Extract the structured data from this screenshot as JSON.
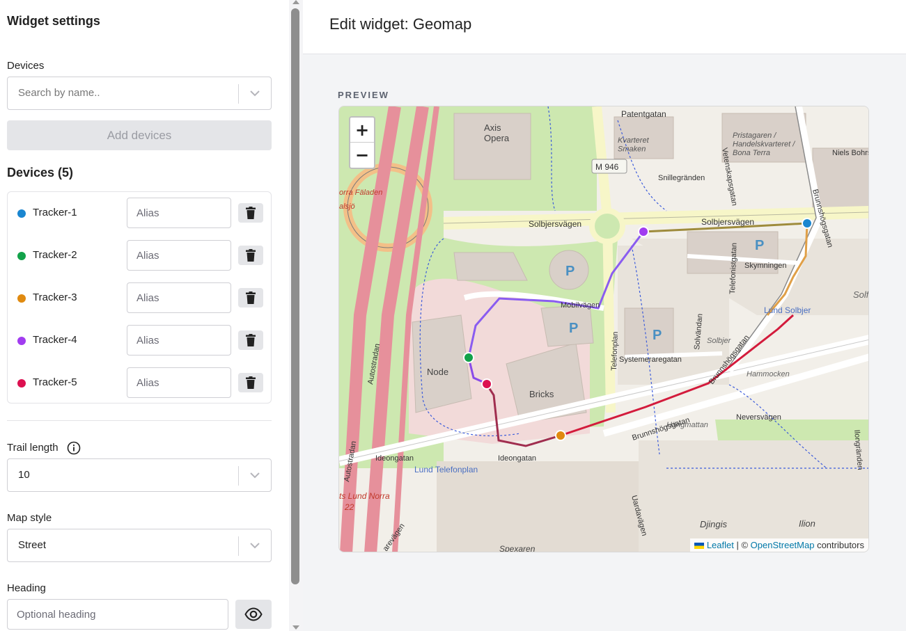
{
  "sidebar": {
    "title": "Widget settings",
    "devices_label": "Devices",
    "search_placeholder": "Search by name..",
    "add_devices_label": "Add devices",
    "devices_heading": "Devices (5)",
    "devices": [
      {
        "name": "Tracker-1",
        "color": "#1a86d0",
        "alias_placeholder": "Alias"
      },
      {
        "name": "Tracker-2",
        "color": "#12a24a",
        "alias_placeholder": "Alias"
      },
      {
        "name": "Tracker-3",
        "color": "#e08a10",
        "alias_placeholder": "Alias"
      },
      {
        "name": "Tracker-4",
        "color": "#a13cf0",
        "alias_placeholder": "Alias"
      },
      {
        "name": "Tracker-5",
        "color": "#dc1050",
        "alias_placeholder": "Alias"
      }
    ],
    "trail_length_label": "Trail length",
    "trail_length_value": "10",
    "map_style_label": "Map style",
    "map_style_value": "Street",
    "heading_label": "Heading",
    "heading_placeholder": "Optional heading"
  },
  "main": {
    "title": "Edit widget: Geomap",
    "preview_label": "PREVIEW"
  },
  "map": {
    "zoom_in": "+",
    "zoom_out": "−",
    "attribution_leaflet": "Leaflet",
    "attribution_sep": " | © ",
    "attribution_osm": "OpenStreetMap",
    "attribution_suffix": " contributors",
    "labels": {
      "patentgatan": "Patentgatan",
      "axis_opera": "Axis\nOpera",
      "kvarteret_smaken": "Kvarteret\nSmaken",
      "pristagaren": "Pristagaren /\nHandelskvarteret /\nBona Terra",
      "niels_bohrs": "Niels Bohrs",
      "m946": "M 946",
      "snillegranden": "Snillegränden",
      "norra_faladen": "orra Fäladen",
      "alsjo": "alsjö",
      "solbjersvagen_w": "Solbjersvägen",
      "solbjersvagen_e": "Solbjersvägen",
      "mobilvagen": "Mobilvägen",
      "skymningen": "Skymningen",
      "lund_solbjer": "Lund Solbjer",
      "solvandan": "Solvändan",
      "solbjer": "Solbjer",
      "systemeraregatan": "Systemeraregatan",
      "hammocken": "Hammocken",
      "node": "Node",
      "bricks": "Bricks",
      "autostradan_top": "Autostradan",
      "autostradan_bottom": "Autostradan",
      "brunnshogsgatan": "Brunnshögsgatan",
      "neversvagen": "Neversvägen",
      "hangmattan": "Hängmattan",
      "ideongatan_w": "Ideongatan",
      "ideongatan_e": "Ideongatan",
      "lund_telefonplan": "Lund Telefonplan",
      "lund_norra": "ts Lund Norra",
      "lund_norra_num": "22",
      "uardavagen": "Uardavägen",
      "djingis": "Djingis",
      "ilion": "Ilion",
      "spexaren": "Spexaren",
      "ilongranden": "Ilongränden",
      "sarevagen": "arevägen",
      "telefonistgatan": "Telefonistgatan",
      "telefonplan_road": "Telefonplan",
      "vetenskapsgatan": "Vetenskapsgatan",
      "brunnshogsgatan_n": "Brunnshögsgatan",
      "solf": "Solf"
    }
  }
}
